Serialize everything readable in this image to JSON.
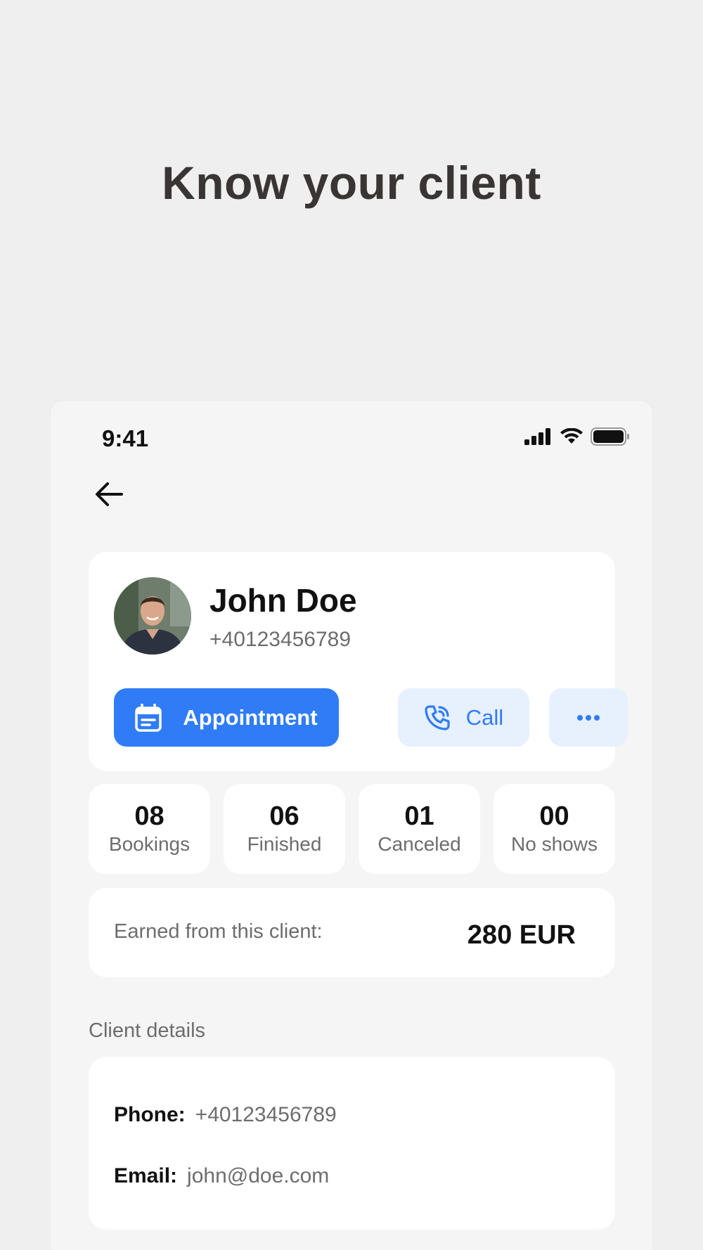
{
  "headline": "Know your client",
  "status_bar": {
    "time": "9:41"
  },
  "client": {
    "name": "John Doe",
    "phone": "+40123456789"
  },
  "actions": {
    "appointment_label": "Appointment",
    "call_label": "Call"
  },
  "stats": [
    {
      "value": "08",
      "label": "Bookings"
    },
    {
      "value": "06",
      "label": "Finished"
    },
    {
      "value": "01",
      "label": "Canceled"
    },
    {
      "value": "00",
      "label": "No shows"
    }
  ],
  "earned": {
    "label": "Earned from this client:",
    "value": "280 EUR"
  },
  "details": {
    "section_title": "Client details",
    "phone_key": "Phone:",
    "phone_value": "+40123456789",
    "email_key": "Email:",
    "email_value": "john@doe.com"
  },
  "colors": {
    "accent": "#2f7cf6",
    "accent_light": "#e7f0fd",
    "muted_text": "#6d6d6d"
  }
}
